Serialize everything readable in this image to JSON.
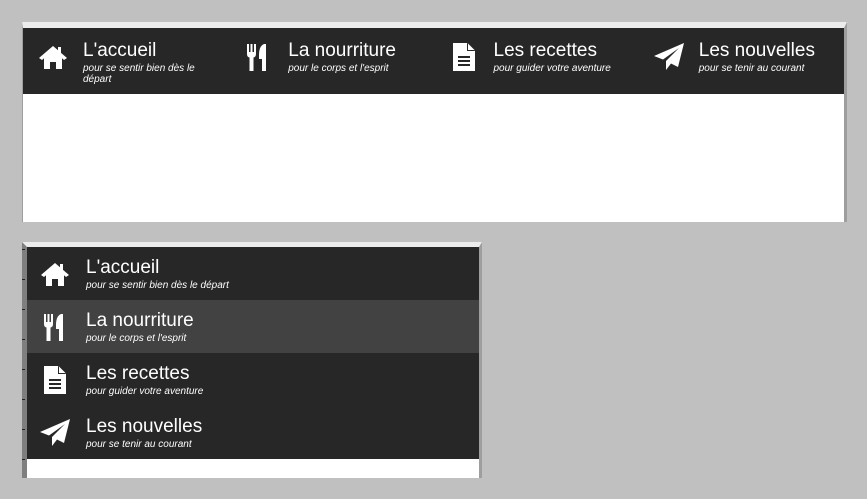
{
  "colors": {
    "nav_background": "#272727",
    "nav_active_background": "#424242",
    "nav_text": "#ffffff",
    "page_background": "#c0c0c0",
    "panel_background": "#ffffff"
  },
  "nav_items": [
    {
      "id": "accueil",
      "icon": "home-icon",
      "title": "L'accueil",
      "subtitle": "pour se sentir bien dès le départ"
    },
    {
      "id": "nourriture",
      "icon": "utensils-icon",
      "title": "La nourriture",
      "subtitle": "pour le corps et l'esprit"
    },
    {
      "id": "recettes",
      "icon": "document-icon",
      "title": "Les recettes",
      "subtitle": "pour guider votre aventure"
    },
    {
      "id": "nouvelles",
      "icon": "paper-plane-icon",
      "title": "Les nouvelles",
      "subtitle": "pour se tenir au courant"
    }
  ],
  "vertical_nav": {
    "active_item": "nourriture"
  }
}
